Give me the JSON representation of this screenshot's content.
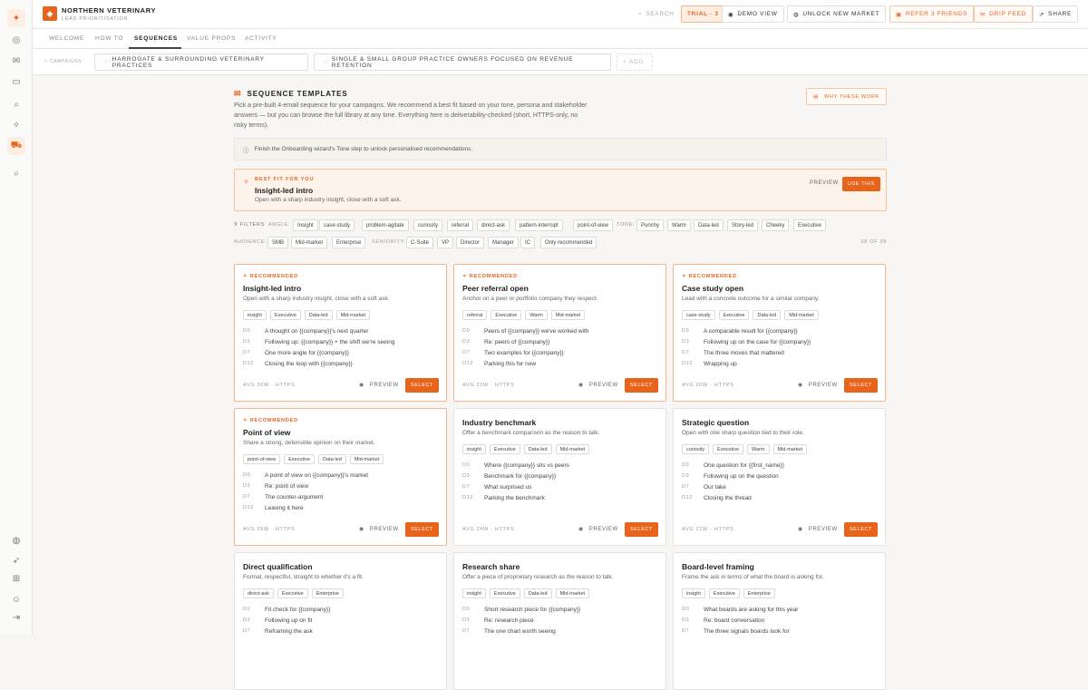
{
  "brand": {
    "name": "NORTHERN VETERINARY",
    "subtitle": "LEAD PRIORITISATION"
  },
  "topbar": {
    "search": "SEARCH",
    "trial": "TRIAL · 3",
    "demo": "DEMO VIEW",
    "unlock": "UNLOCK NEW MARKET",
    "refer": "REFER 3 FRIENDS",
    "drip": "DRIP FEED",
    "share": "SHARE"
  },
  "tabs": [
    "WELCOME",
    "HOW TO",
    "SEQUENCES",
    "VALUE PROPS",
    "ACTIVITY"
  ],
  "campaigns": {
    "label": "CAMPAIGNS",
    "chips": [
      "HARROGATE & SURROUNDING VETERINARY PRACTICES",
      "SINGLE & SMALL GROUP PRACTICE OWNERS FOCUSED ON REVENUE RETENTION"
    ],
    "add": "+ ADD"
  },
  "section": {
    "title": "SEQUENCE TEMPLATES",
    "intro": "Pick a pre-built 4-email sequence for your campaigns. We recommend a best fit based on your tone, persona and stakeholder answers — but you can browse the full library at any time. Everything here is deliverability-checked (short, HTTPS-only, no risky terms).",
    "why": "WHY THESE WORK",
    "note": "Finish the Onboarding wizard's Tone step to unlock personalised recommendations."
  },
  "best": {
    "label": "BEST FIT FOR YOU",
    "title": "Insight-led intro",
    "sub": "Open with a sharp industry insight, close with a soft ask.",
    "preview": "PREVIEW",
    "use": "USE THIS"
  },
  "filters": {
    "label": "FILTERS",
    "angle_label": "ANGLE:",
    "angle": [
      "Insight",
      "case-study",
      "problem-agitate",
      "curiosity",
      "referral",
      "direct-ask",
      "pattern-interrupt",
      "point-of-view"
    ],
    "tone_label": "TONE:",
    "tone": [
      "Punchy",
      "Warm",
      "Data-led",
      "Story-led",
      "Cheeky",
      "Executive"
    ],
    "audience_label": "AUDIENCE:",
    "audience": [
      "SMB",
      "Mid-market",
      "Enterprise"
    ],
    "seniority_label": "SENIORITY:",
    "seniority": [
      "C-Suite",
      "VP",
      "Director",
      "Manager",
      "IC"
    ],
    "only": "Only recommended",
    "count": "38 OF 38"
  },
  "card_labels": {
    "recommended": "RECOMMENDED",
    "preview": "PREVIEW",
    "select": "SELECT"
  },
  "cards": [
    {
      "rec": true,
      "title": "Insight-led intro",
      "sub": "Open with a sharp industry insight, close with a soft ask.",
      "tags": [
        "insight",
        "Executive",
        "Data-led",
        "Mid-market"
      ],
      "steps": [
        [
          "D0",
          "A thought on {{company}}'s next quarter"
        ],
        [
          "D3",
          "Following up: {{company}} + the shift we're seeing"
        ],
        [
          "D7",
          "One more angle for {{company}}"
        ],
        [
          "D12",
          "Closing the loop with {{company}}"
        ]
      ],
      "meta": "AVG 30W · HTTPS"
    },
    {
      "rec": true,
      "title": "Peer referral open",
      "sub": "Anchor on a peer or portfolio company they respect.",
      "tags": [
        "referral",
        "Executive",
        "Warm",
        "Mid-market"
      ],
      "steps": [
        [
          "D0",
          "Peers of {{company}} we've worked with"
        ],
        [
          "D3",
          "Re: peers of {{company}}"
        ],
        [
          "D7",
          "Two examples for {{company}}"
        ],
        [
          "D12",
          "Parking this for now"
        ]
      ],
      "meta": "AVG 23W · HTTPS"
    },
    {
      "rec": true,
      "title": "Case study open",
      "sub": "Lead with a concrete outcome for a similar company.",
      "tags": [
        "case-study",
        "Executive",
        "Data-led",
        "Mid-market"
      ],
      "steps": [
        [
          "D0",
          "A comparable result for {{company}}"
        ],
        [
          "D3",
          "Following up on the case for {{company}}"
        ],
        [
          "D7",
          "The three moves that mattered"
        ],
        [
          "D12",
          "Wrapping up"
        ]
      ],
      "meta": "AVG 26W · HTTPS"
    },
    {
      "rec": true,
      "title": "Point of view",
      "sub": "Share a strong, defensible opinion on their market.",
      "tags": [
        "point-of-view",
        "Executive",
        "Data-led",
        "Mid-market"
      ],
      "steps": [
        [
          "D0",
          "A point of view on {{company}}'s market"
        ],
        [
          "D3",
          "Re: point of view"
        ],
        [
          "D7",
          "The counter-argument"
        ],
        [
          "D12",
          "Leaving it here"
        ]
      ],
      "meta": "AVG 25W · HTTPS"
    },
    {
      "rec": false,
      "title": "Industry benchmark",
      "sub": "Offer a benchmark comparison as the reason to talk.",
      "tags": [
        "insight",
        "Executive",
        "Data-led",
        "Mid-market"
      ],
      "steps": [
        [
          "D0",
          "Where {{company}} sits vs peers"
        ],
        [
          "D3",
          "Benchmark for {{company}}"
        ],
        [
          "D7",
          "What surprised us"
        ],
        [
          "D12",
          "Parking the benchmark"
        ]
      ],
      "meta": "AVG 24W · HTTPS"
    },
    {
      "rec": false,
      "title": "Strategic question",
      "sub": "Open with one sharp question tied to their role.",
      "tags": [
        "curiosity",
        "Executive",
        "Warm",
        "Mid-market"
      ],
      "steps": [
        [
          "D0",
          "One question for {{first_name}}"
        ],
        [
          "D3",
          "Following up on the question"
        ],
        [
          "D7",
          "Our take"
        ],
        [
          "D12",
          "Closing the thread"
        ]
      ],
      "meta": "AVG 21W · HTTPS"
    },
    {
      "rec": false,
      "title": "Direct qualification",
      "sub": "Formal, respectful, straight to whether it's a fit.",
      "tags": [
        "direct-ask",
        "Executive",
        "Enterprise"
      ],
      "steps": [
        [
          "D0",
          "Fit check for {{company}}"
        ],
        [
          "D3",
          "Following up on fit"
        ],
        [
          "D7",
          "Reframing the ask"
        ]
      ],
      "meta": ""
    },
    {
      "rec": false,
      "title": "Research share",
      "sub": "Offer a piece of proprietary research as the reason to talk.",
      "tags": [
        "insight",
        "Executive",
        "Data-led",
        "Mid-market"
      ],
      "steps": [
        [
          "D0",
          "Short research piece for {{company}}"
        ],
        [
          "D3",
          "Re: research piece"
        ],
        [
          "D7",
          "The one chart worth seeing"
        ]
      ],
      "meta": ""
    },
    {
      "rec": false,
      "title": "Board-level framing",
      "sub": "Frame the ask in terms of what the board is asking for.",
      "tags": [
        "insight",
        "Executive",
        "Enterprise"
      ],
      "steps": [
        [
          "D0",
          "What boards are asking for this year"
        ],
        [
          "D3",
          "Re: board conversation"
        ],
        [
          "D7",
          "The three signals boards look for"
        ]
      ],
      "meta": ""
    }
  ]
}
